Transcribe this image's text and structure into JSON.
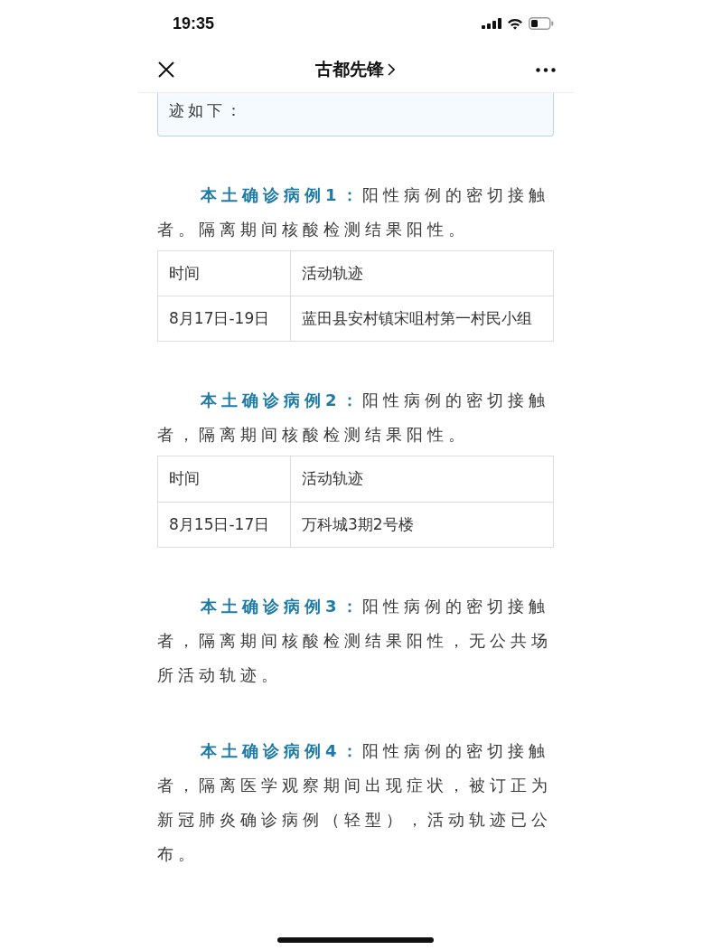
{
  "status_bar": {
    "time": "19:35"
  },
  "nav": {
    "title": "古都先锋"
  },
  "intro_box": {
    "text": "迹如下："
  },
  "cases": [
    {
      "lead": "本土确诊病例1：",
      "text": "阳性病例的密切接触者。隔离期间核酸检测结果阳性。",
      "table": {
        "columns": [
          "时间",
          "活动轨迹"
        ],
        "rows": [
          [
            "8月17日-19日",
            "蓝田县安村镇宋咀村第一村民小组"
          ]
        ]
      }
    },
    {
      "lead": "本土确诊病例2：",
      "text": "阳性病例的密切接触者，隔离期间核酸检测结果阳性。",
      "table": {
        "columns": [
          "时间",
          "活动轨迹"
        ],
        "rows": [
          [
            "8月15日-17日",
            "万科城3期2号楼"
          ]
        ]
      }
    },
    {
      "lead": "本土确诊病例3：",
      "text": "阳性病例的密切接触者，隔离期间核酸检测结果阳性，无公共场所活动轨迹。"
    },
    {
      "lead": "本土确诊病例4：",
      "text": "阳性病例的密切接触者，隔离医学观察期间出现症状，被订正为新冠肺炎确诊病例（轻型），活动轨迹已公布。"
    }
  ]
}
